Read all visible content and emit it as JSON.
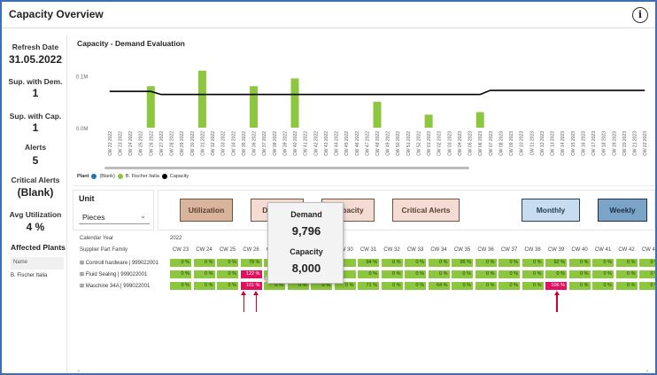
{
  "header": {
    "title": "Capacity Overview",
    "info_glyph": "i"
  },
  "kpis": [
    {
      "label": "Refresh Date",
      "value": "31.05.2022"
    },
    {
      "label": "Sup. with Dem.",
      "value": "1"
    },
    {
      "label": "Sup. with Cap.",
      "value": "1"
    },
    {
      "label": "Alerts",
      "value": "5"
    },
    {
      "label": "Critical Alerts",
      "value": "(Blank)"
    },
    {
      "label": "Avg Utilization",
      "value": "4 %"
    }
  ],
  "affected_plants": {
    "title": "Affected Plants",
    "column": "Name",
    "items": [
      "B. Fischer Italia"
    ]
  },
  "chart": {
    "title": "Capacity - Demand Evaluation"
  },
  "chart_data": {
    "type": "bar",
    "title": "Capacity - Demand Evaluation",
    "ytick_labels": [
      "0.1M",
      "0.0M"
    ],
    "categories": [
      "CW 22 2022",
      "CW 23 2022",
      "CW 24 2022",
      "CW 25 2022",
      "CW 26 2022",
      "CW 27 2022",
      "CW 28 2022",
      "CW 29 2022",
      "CW 30 2022",
      "CW 31 2022",
      "CW 32 2022",
      "CW 33 2022",
      "CW 34 2022",
      "CW 35 2022",
      "CW 36 2022",
      "CW 37 2022",
      "CW 38 2022",
      "CW 39 2022",
      "CW 40 2022",
      "CW 41 2022",
      "CW 42 2022",
      "CW 43 2022",
      "CW 44 2022",
      "CW 45 2022",
      "CW 46 2022",
      "CW 47 2022",
      "CW 48 2022",
      "CW 49 2022",
      "CW 50 2022",
      "CW 51 2022",
      "CW 52 2022",
      "CW 01 2023",
      "CW 02 2023",
      "CW 03 2023",
      "CW 04 2023",
      "CW 05 2023",
      "CW 06 2023",
      "CW 07 2023",
      "CW 08 2023",
      "CW 09 2023",
      "CW 10 2023",
      "CW 11 2023",
      "CW 12 2023",
      "CW 13 2023",
      "CW 14 2023",
      "CW 15 2023",
      "CW 16 2023",
      "CW 17 2023",
      "CW 18 2023",
      "CW 19 2023",
      "CW 20 2023",
      "CW 21 2023",
      "CW 22 2023"
    ],
    "series": [
      {
        "name": "B. Fischer Italia",
        "type": "bar",
        "color": "#8dc63f",
        "values": [
          0,
          0,
          0,
          0,
          80000,
          0,
          0,
          0,
          0,
          110000,
          0,
          0,
          0,
          0,
          80000,
          0,
          0,
          0,
          95000,
          0,
          0,
          0,
          0,
          0,
          0,
          0,
          50000,
          0,
          0,
          0,
          0,
          25000,
          0,
          0,
          0,
          0,
          30000,
          0,
          0,
          0,
          0,
          0,
          0,
          0,
          0,
          0,
          0,
          0,
          0,
          0,
          0,
          0,
          0
        ]
      },
      {
        "name": "Capacity",
        "type": "line",
        "color": "#000000",
        "values": [
          70000,
          70000,
          70000,
          70000,
          70000,
          64000,
          64000,
          64000,
          64000,
          64000,
          64000,
          64000,
          64000,
          64000,
          64000,
          64000,
          64000,
          64000,
          64000,
          64000,
          64000,
          64000,
          64000,
          64000,
          64000,
          64000,
          64000,
          64000,
          64000,
          64000,
          64000,
          64000,
          64000,
          64000,
          64000,
          64000,
          64000,
          72000,
          72000,
          72000,
          72000,
          72000,
          72000,
          72000,
          72000,
          72000,
          72000,
          72000,
          72000,
          72000,
          72000,
          72000,
          72000
        ]
      }
    ],
    "ylim": [
      0,
      130000
    ],
    "legend": {
      "title": "Plant",
      "items": [
        {
          "name": "(Blank)",
          "color": "#1f6fb5"
        },
        {
          "name": "B. Fischer Italia",
          "color": "#8dc63f"
        },
        {
          "name": "Capacity",
          "color": "#000000"
        }
      ],
      "placement": "bottom-left"
    }
  },
  "unit": {
    "label": "Unit",
    "value": "Pieces"
  },
  "buttons": [
    {
      "label": "Utilization",
      "style": "tan"
    },
    {
      "label": "Demand",
      "style": "pink"
    },
    {
      "label": "Capacity",
      "style": "pink"
    },
    {
      "label": "Critical Alerts",
      "style": "pink"
    },
    {
      "label": "Monthly",
      "style": "blue1"
    },
    {
      "label": "Weekly",
      "style": "blue2"
    }
  ],
  "table": {
    "header_year_label": "Calendar Year",
    "year": "2022",
    "row_header": "Supplier Part Family",
    "columns": [
      "CW 23",
      "CW 24",
      "CW 25",
      "CW 26",
      "CW 27",
      "CW 28",
      "CW 29",
      "CW 30",
      "CW 31",
      "CW 32",
      "CW 33",
      "CW 34",
      "CW 35",
      "CW 36",
      "CW 37",
      "CW 38",
      "CW 39",
      "CW 40",
      "CW 41",
      "CW 42",
      "CW 43",
      "CW"
    ],
    "rows": [
      {
        "label": "Controll hardware | 999022001",
        "cells": [
          "0 %",
          "0 %",
          "0 %",
          "78 %",
          "",
          "",
          "",
          "",
          "94 %",
          "0 %",
          "0 %",
          "0 %",
          "95 %",
          "0 %",
          "0 %",
          "0 %",
          "92 %",
          "0 %",
          "0 %",
          "0 %",
          "0 %",
          ""
        ],
        "red": [
          21
        ]
      },
      {
        "label": "Fluid Sealing | 999022001",
        "cells": [
          "0 %",
          "0 %",
          "0 %",
          "122 %",
          "",
          "",
          "",
          "",
          "0 %",
          "0 %",
          "0 %",
          "0 %",
          "0 %",
          "0 %",
          "0 %",
          "0 %",
          "0 %",
          "0 %",
          "0 %",
          "0 %",
          "0 %",
          ""
        ],
        "red": [
          3
        ]
      },
      {
        "label": "Maschine 34A | 999022001",
        "cells": [
          "0 %",
          "0 %",
          "0 %",
          "101 %",
          "0 %",
          "0 %",
          "0 %",
          "0 %",
          "71 %",
          "0 %",
          "0 %",
          "64 %",
          "0 %",
          "0 %",
          "0 %",
          "0 %",
          "106 %",
          "0 %",
          "0 %",
          "0 %",
          "0 %",
          ""
        ],
        "red": [
          3,
          16
        ]
      }
    ]
  },
  "tooltip": {
    "label1": "Demand",
    "value1": "9,796",
    "label2": "Capacity",
    "value2": "8,000"
  }
}
